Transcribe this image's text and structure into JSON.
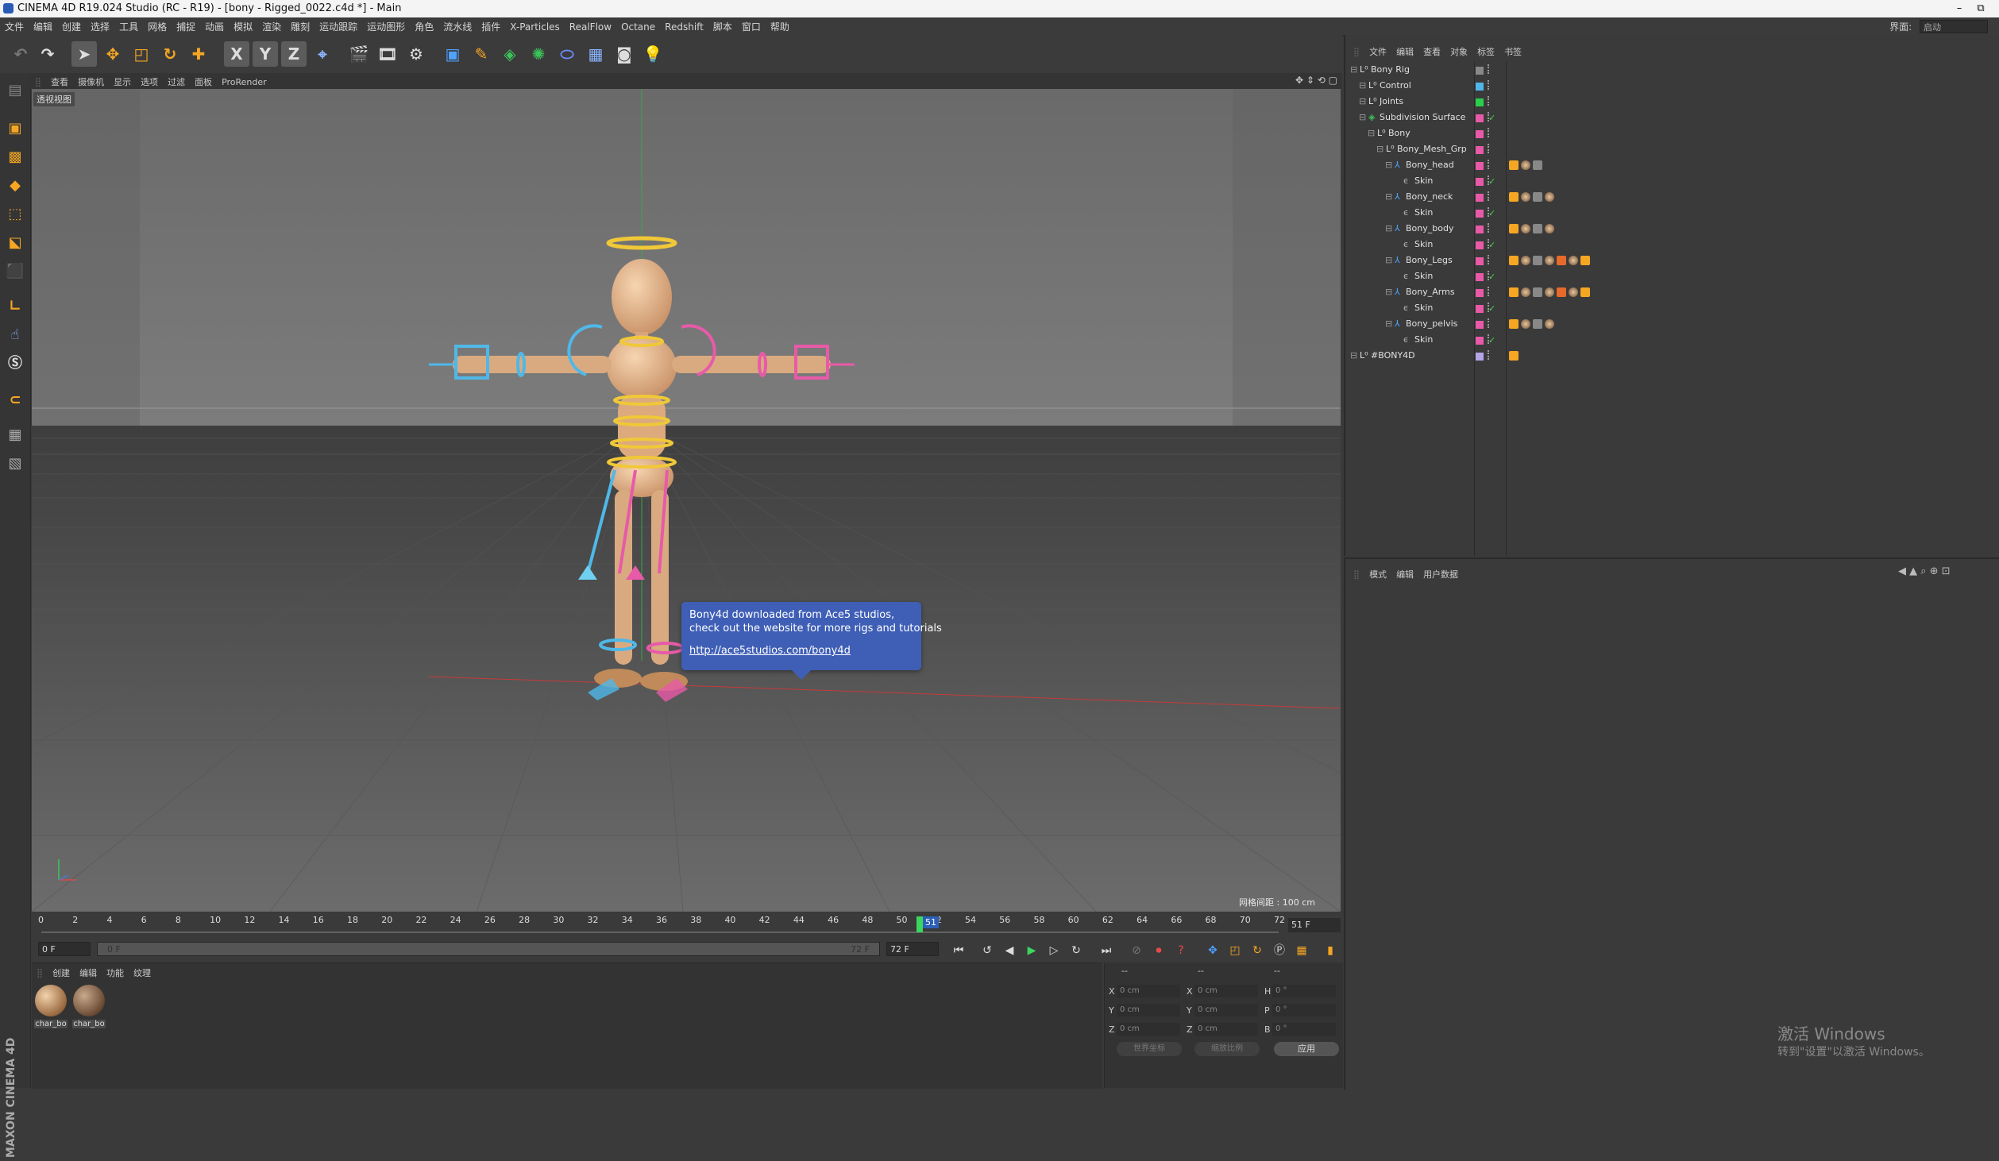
{
  "window": {
    "title": "CINEMA 4D R19.024 Studio (RC - R19) - [bony - Rigged_0022.c4d *] - Main",
    "minimize": "–",
    "maximize": "⧉"
  },
  "menubar": {
    "items": [
      "文件",
      "编辑",
      "创建",
      "选择",
      "工具",
      "网格",
      "捕捉",
      "动画",
      "模拟",
      "渲染",
      "雕刻",
      "运动跟踪",
      "运动图形",
      "角色",
      "流水线",
      "插件",
      "X-Particles",
      "RealFlow",
      "Octane",
      "Redshift",
      "脚本",
      "窗口",
      "帮助"
    ],
    "layout_label": "界面:",
    "layout_value": "启动"
  },
  "toolbar": {
    "icons": [
      "undo-icon",
      "redo-icon",
      "select-arrow-icon",
      "move-icon",
      "scale-icon",
      "rotate-icon",
      "add-icon",
      "x-axis-icon",
      "y-axis-icon",
      "z-axis-icon",
      "coordinate-system-icon",
      "render-view-icon",
      "render-picture-viewer-icon",
      "render-settings-icon",
      "cube-icon",
      "pen-icon",
      "subdivision-icon",
      "cloner-icon",
      "deformer-icon",
      "floor-icon",
      "camera-icon",
      "light-icon"
    ],
    "xyz": [
      "X",
      "Y",
      "Z"
    ]
  },
  "viewport": {
    "menu": [
      "查看",
      "摄像机",
      "显示",
      "选项",
      "过滤",
      "面板",
      "ProRender"
    ],
    "label": "透视视图",
    "grid_label": "网格间距 : 100 cm",
    "tooltip": {
      "line1": "Bony4d downloaded from Ace5 studios,",
      "line2": "check out the website for more rigs and tutorials",
      "link": "http://ace5studios.com/bony4d"
    }
  },
  "timeline": {
    "ticks": [
      "0",
      "2",
      "4",
      "6",
      "8",
      "10",
      "12",
      "14",
      "16",
      "18",
      "20",
      "22",
      "24",
      "26",
      "28",
      "30",
      "32",
      "34",
      "36",
      "38",
      "40",
      "42",
      "44",
      "46",
      "48",
      "50",
      "52",
      "54",
      "56",
      "58",
      "60",
      "62",
      "64",
      "66",
      "68",
      "70",
      "72"
    ],
    "current_frame_label": "51",
    "current_frame_box": "51 F",
    "start_field": "0 F",
    "range_start": "0 F",
    "range_end": "72 F",
    "end_field": "72 F"
  },
  "materials": {
    "menu": [
      "创建",
      "编辑",
      "功能",
      "纹理"
    ],
    "items": [
      {
        "label": "char_bo"
      },
      {
        "label": "char_bo"
      }
    ]
  },
  "coords": {
    "headers": [
      "--",
      "--",
      "--"
    ],
    "rows": [
      {
        "a": "X",
        "av": "0 cm",
        "b": "X",
        "bv": "0 cm",
        "c": "H",
        "cv": "0 °"
      },
      {
        "a": "Y",
        "av": "0 cm",
        "b": "Y",
        "bv": "0 cm",
        "c": "P",
        "cv": "0 °"
      },
      {
        "a": "Z",
        "av": "0 cm",
        "b": "Z",
        "bv": "0 cm",
        "c": "B",
        "cv": "0 °"
      }
    ],
    "dropdown1": "世界坐标",
    "dropdown2": "缩放比例",
    "apply": "应用"
  },
  "objects": {
    "menu": [
      "文件",
      "编辑",
      "查看",
      "对象",
      "标签",
      "书签"
    ],
    "rows": [
      {
        "name": "Bony Rig",
        "color": "#888888",
        "check": ""
      },
      {
        "name": "Control",
        "color": "#4fb8e8",
        "check": ""
      },
      {
        "name": "Joints",
        "color": "#2ad04a",
        "check": ""
      },
      {
        "name": "Subdivision Surface",
        "color": "#e85aa8",
        "check": "✓"
      },
      {
        "name": "Bony",
        "color": "#e85aa8",
        "check": ""
      },
      {
        "name": "Bony_Mesh_Grp",
        "color": "#e85aa8",
        "check": ""
      },
      {
        "name": "Bony_head",
        "color": "#e85aa8",
        "check": ""
      },
      {
        "name": "Skin",
        "color": "#e85aa8",
        "check": "✓"
      },
      {
        "name": "Bony_neck",
        "color": "#e85aa8",
        "check": ""
      },
      {
        "name": "Skin",
        "color": "#e85aa8",
        "check": "✓"
      },
      {
        "name": "Bony_body",
        "color": "#e85aa8",
        "check": ""
      },
      {
        "name": "Skin",
        "color": "#e85aa8",
        "check": "✓"
      },
      {
        "name": "Bony_Legs",
        "color": "#e85aa8",
        "check": ""
      },
      {
        "name": "Skin",
        "color": "#e85aa8",
        "check": "✓"
      },
      {
        "name": "Bony_Arms",
        "color": "#e85aa8",
        "check": ""
      },
      {
        "name": "Skin",
        "color": "#e85aa8",
        "check": "✓"
      },
      {
        "name": "Bony_pelvis",
        "color": "#e85aa8",
        "check": ""
      },
      {
        "name": "Skin",
        "color": "#e85aa8",
        "check": "✓"
      },
      {
        "name": "#BONY4D",
        "color": "#b7a3e8",
        "check": ""
      }
    ]
  },
  "attributes": {
    "menu": [
      "模式",
      "编辑",
      "用户数据"
    ]
  },
  "windows_activation": {
    "line1": "激活 Windows",
    "line2": "转到\"设置\"以激活 Windows。"
  }
}
